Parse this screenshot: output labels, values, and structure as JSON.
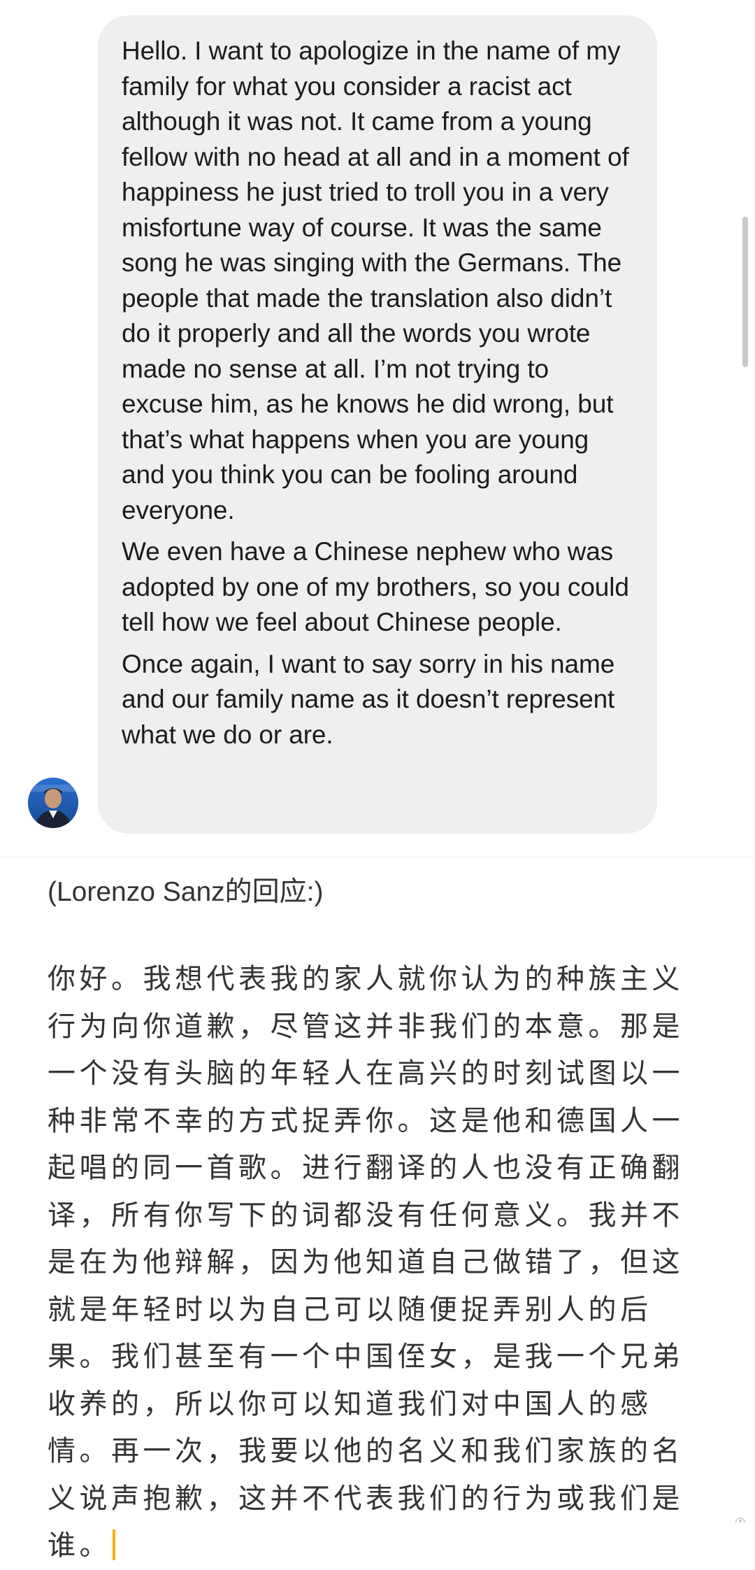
{
  "message": {
    "paragraphs": [
      "Hello. I want to apologize in the name of my family for what you consider a racist act although it was not. It came from a young fellow with no head at all and in a moment of happiness he just tried to troll you in a very misfortune way of course. It was the same song he was singing with the Germans. The people that made the translation also didn’t do it properly and all the words you wrote made no sense at all. I’m not trying to excuse him, as he knows he did wrong, but that’s what happens when you are young and you think you can be fooling around everyone.",
      "We even have a Chinese nephew who was adopted by one of my brothers, so you could tell how we feel about Chinese people.",
      "Once again, I want to say sorry in his name and our family name as it doesn’t represent what we do or are."
    ]
  },
  "caption": "(Lorenzo Sanz的回应:)",
  "translation": "你好。我想代表我的家人就你认为的种族主义行为向你道歉，尽管这并非我们的本意。那是一个没有头脑的年轻人在高兴的时刻试图以一种非常不幸的方式捉弄你。这是他和德国人一起唱的同一首歌。进行翻译的人也没有正确翻译，所有你写下的词都没有任何意义。我并不是在为他辩解，因为他知道自己做错了，但这就是年轻时以为自己可以随便捉弄别人的后果。我们甚至有一个中国侄女，是我一个兄弟收养的，所以你可以知道我们对中国人的感情。再一次，我要以他的名义和我们家族的名义说声抱歉，这并不代表我们的行为或我们是谁。",
  "icons": {
    "avatar": "sender-avatar-icon",
    "cursor": "text-cursor-icon",
    "watermark": "watermark-icon"
  },
  "colors": {
    "bubble_background": "#efeff1",
    "message_text": "#1c1c1e",
    "translation_text": "#333333",
    "cursor": "#f0b400",
    "scrollbar": "#c9c9cc"
  }
}
